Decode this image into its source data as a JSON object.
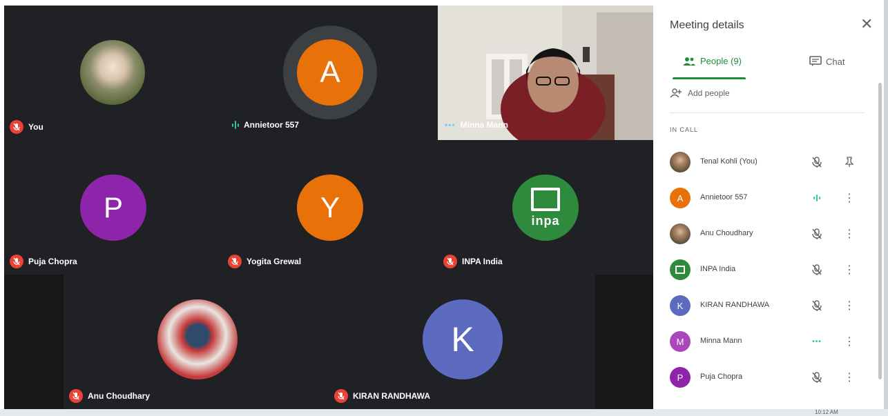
{
  "tiles": {
    "you": {
      "label": "You"
    },
    "annietoor": {
      "label": "Annietoor 557",
      "initial": "A",
      "color": "#e8710a"
    },
    "minna": {
      "label": "Minna Mann"
    },
    "puja": {
      "label": "Puja Chopra",
      "initial": "P",
      "color": "#8e24aa"
    },
    "yogita": {
      "label": "Yogita Grewal",
      "initial": "Y",
      "color": "#e8710a"
    },
    "inpa": {
      "label": "INPA India",
      "logo_text": "inpa"
    },
    "anu": {
      "label": "Anu Choudhary"
    },
    "kiran": {
      "label": "KIRAN RANDHAWA",
      "initial": "K",
      "color": "#5c6bc0"
    }
  },
  "panel": {
    "title": "Meeting details",
    "tabs": {
      "people": "People (9)",
      "chat": "Chat"
    },
    "add_people": "Add people",
    "in_call": "IN CALL",
    "participants": [
      {
        "name": "Tenal Kohli (You)",
        "avatar": "photo",
        "status": "muted",
        "action": "pin-icon"
      },
      {
        "name": "Annietoor 557",
        "initial": "A",
        "color": "#e8710a",
        "status": "speaking",
        "action": "more-icon"
      },
      {
        "name": "Anu Choudhary",
        "avatar": "photo",
        "status": "muted",
        "action": "more-icon"
      },
      {
        "name": "INPA India",
        "avatar": "logo",
        "status": "muted",
        "action": "more-icon"
      },
      {
        "name": "KIRAN RANDHAWA",
        "initial": "K",
        "color": "#5c6bc0",
        "status": "muted",
        "action": "more-icon"
      },
      {
        "name": "Minna Mann",
        "initial": "M",
        "color": "#ab47bc",
        "status": "active",
        "action": "more-icon"
      },
      {
        "name": "Puja Chopra",
        "initial": "P",
        "color": "#8e24aa",
        "status": "muted",
        "action": "more-icon"
      }
    ]
  },
  "taskbar": {
    "time": "10:12 AM"
  },
  "colors": {
    "accent": "#1e8e3e",
    "muted_red": "#ea4335",
    "grid_bg": "#202124"
  }
}
